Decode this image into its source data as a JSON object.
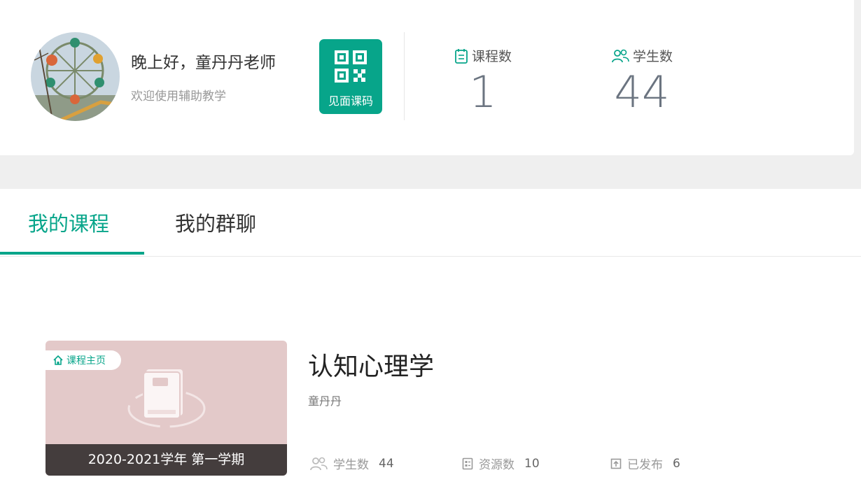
{
  "header": {
    "greeting": "晚上好，童丹丹老师",
    "welcome": "欢迎使用辅助教学",
    "qr_label": "见面课码",
    "stats": {
      "courses_label": "课程数",
      "courses_value": "1",
      "students_label": "学生数",
      "students_value": "44"
    }
  },
  "tabs": [
    {
      "label": "我的课程",
      "active": true
    },
    {
      "label": "我的群聊",
      "active": false
    }
  ],
  "course": {
    "badge": "课程主页",
    "term": "2020-2021学年 第一学期",
    "title": "认知心理学",
    "teacher": "童丹丹",
    "students_label": "学生数",
    "students_value": "44",
    "resources_label": "资源数",
    "resources_value": "10",
    "published_label": "已发布",
    "published_value": "6"
  },
  "colors": {
    "accent": "#07a58a",
    "cover_bg": "#e3c9c9",
    "term_bar": "#443d3d"
  }
}
